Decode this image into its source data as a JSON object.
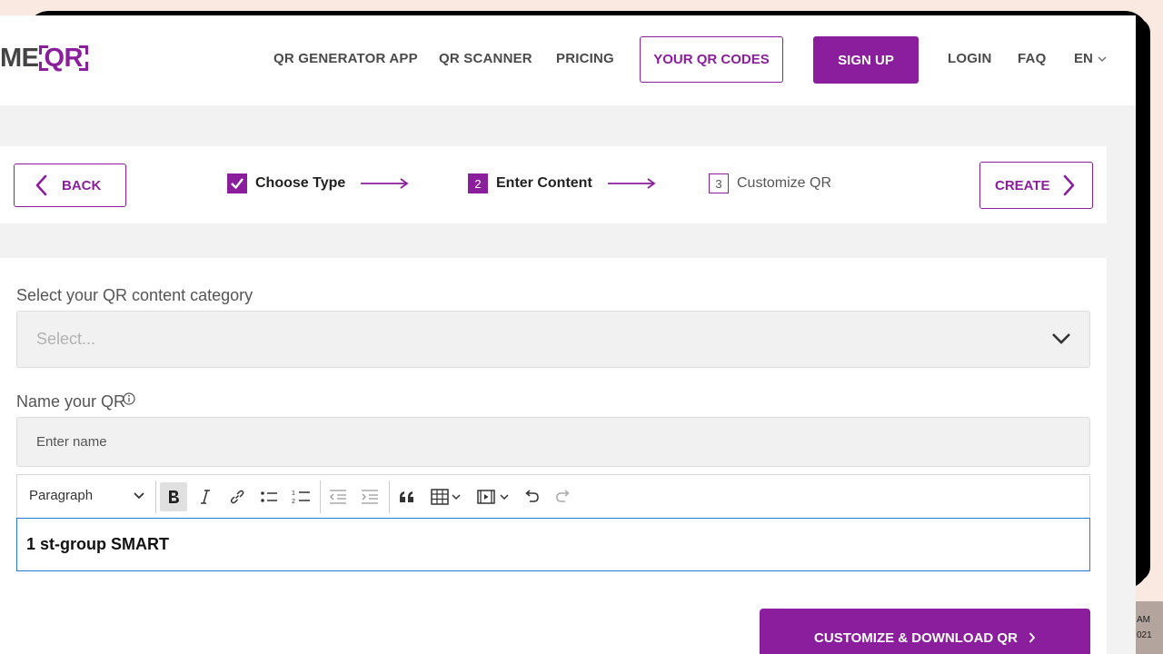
{
  "logo": {
    "part1": "ME",
    "part2": "QR"
  },
  "nav": {
    "generator": "QR GENERATOR APP",
    "scanner": "QR SCANNER",
    "pricing": "PRICING",
    "your_codes": "YOUR QR CODES",
    "signup": "SIGN UP",
    "login": "LOGIN",
    "faq": "FAQ",
    "lang": "EN"
  },
  "steps": {
    "back": "BACK",
    "create": "CREATE",
    "step1": {
      "label": "Choose Type",
      "state": "done"
    },
    "step2": {
      "number": "2",
      "label": "Enter Content",
      "state": "current"
    },
    "step3": {
      "number": "3",
      "label": "Customize QR",
      "state": "upcoming"
    }
  },
  "form": {
    "category_label": "Select your QR content category",
    "category_placeholder": "Select...",
    "name_label": "Name your QR",
    "name_placeholder": "Enter name",
    "editor_format": "Paragraph",
    "editor_content": "1 st-group SMART",
    "cta": "CUSTOMIZE & DOWNLOAD QR"
  },
  "taskbar": {
    "time": "AM",
    "date": "021"
  },
  "colors": {
    "accent": "#8a1e9c",
    "focus": "#2b7bd6"
  }
}
